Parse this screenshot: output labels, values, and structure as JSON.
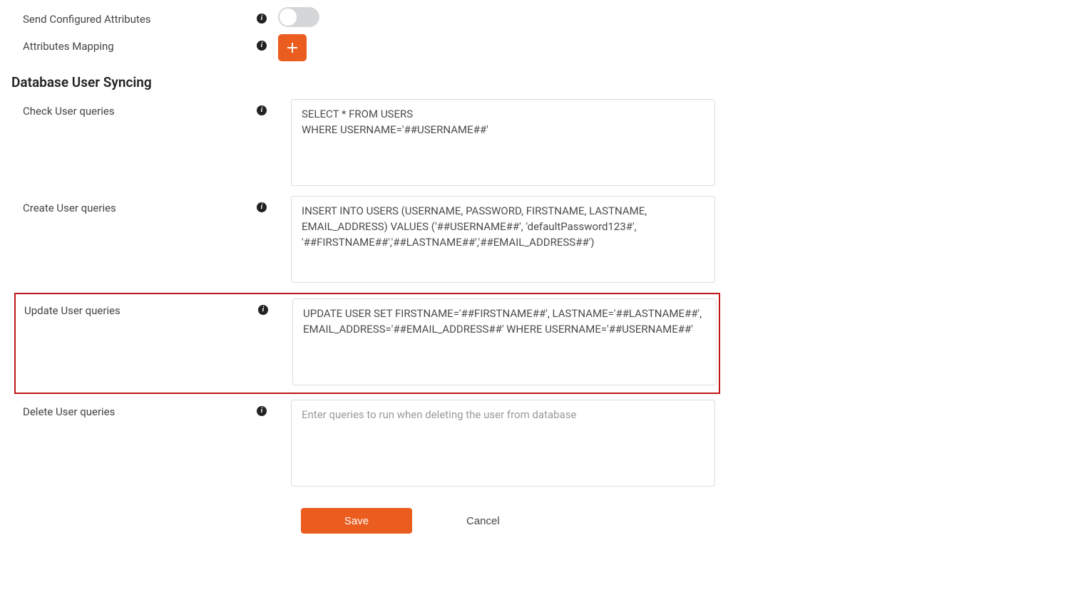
{
  "attributes": {
    "send_label": "Send Configured Attributes",
    "mapping_label": "Attributes Mapping"
  },
  "syncing": {
    "heading": "Database User Syncing",
    "check_label": "Check User queries",
    "check_value": "SELECT * FROM USERS\nWHERE USERNAME='##USERNAME##'",
    "create_label": "Create User queries",
    "create_value": "INSERT INTO USERS (USERNAME, PASSWORD, FIRSTNAME, LASTNAME, EMAIL_ADDRESS) VALUES ('##USERNAME##', 'defaultPassword123#', '##FIRSTNAME##','##LASTNAME##','##EMAIL_ADDRESS##')",
    "update_label": "Update User queries",
    "update_value": "UPDATE USER SET FIRSTNAME='##FIRSTNAME##', LASTNAME='##LASTNAME##', EMAIL_ADDRESS='##EMAIL_ADDRESS##' WHERE USERNAME='##USERNAME##'",
    "delete_label": "Delete User queries",
    "delete_placeholder": "Enter queries to run when deleting the user from database"
  },
  "buttons": {
    "save": "Save",
    "cancel": "Cancel"
  }
}
